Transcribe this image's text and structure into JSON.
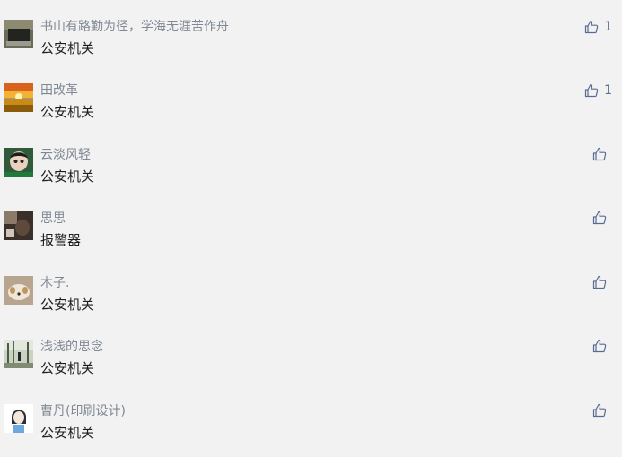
{
  "colors": {
    "background": "#f2f2f2",
    "nickname": "#7f8893",
    "content": "#1e1e1e",
    "like": "#576b95"
  },
  "comments": [
    {
      "name": "书山有路勤为径，学海无涯苦作舟",
      "content": "公安机关",
      "likes": "1",
      "avatar": "laptop-photo-avatar",
      "like_icon": "thumbs-up-icon"
    },
    {
      "name": "田改革",
      "content": "公安机关",
      "likes": "1",
      "avatar": "sunset-photo-avatar",
      "like_icon": "thumbs-up-icon"
    },
    {
      "name": "云淡风轻",
      "content": "公安机关",
      "likes": "",
      "avatar": "child-photo-avatar",
      "like_icon": "thumbs-up-icon"
    },
    {
      "name": "思思",
      "content": "报警器",
      "likes": "",
      "avatar": "dark-photo-avatar",
      "like_icon": "thumbs-up-icon"
    },
    {
      "name": "木子.",
      "content": "公安机关",
      "likes": "",
      "avatar": "dog-photo-avatar",
      "like_icon": "thumbs-up-icon"
    },
    {
      "name": "浅浅的思念",
      "content": "公安机关",
      "likes": "",
      "avatar": "park-photo-avatar",
      "like_icon": "thumbs-up-icon"
    },
    {
      "name": "曹丹(印刷设计)",
      "content": "公安机关",
      "likes": "",
      "avatar": "cartoon-girl-avatar",
      "like_icon": "thumbs-up-icon"
    }
  ]
}
